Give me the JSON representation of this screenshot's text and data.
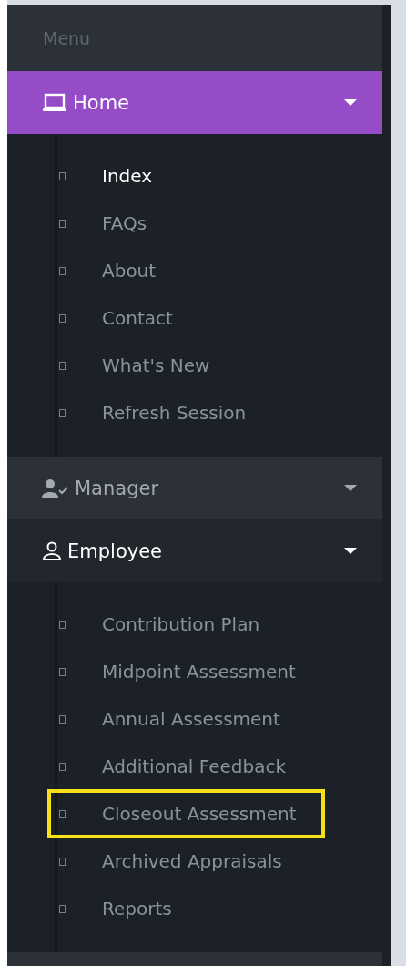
{
  "menu_title": "Menu",
  "groups": [
    {
      "label": "Home",
      "kind": "laptop",
      "active": true,
      "expanded": true,
      "items": [
        {
          "label": "Index",
          "selected": true,
          "highlighted": false
        },
        {
          "label": "FAQs",
          "selected": false,
          "highlighted": false
        },
        {
          "label": "About",
          "selected": false,
          "highlighted": false
        },
        {
          "label": "Contact",
          "selected": false,
          "highlighted": false
        },
        {
          "label": "What's New",
          "selected": false,
          "highlighted": false
        },
        {
          "label": "Refresh Session",
          "selected": false,
          "highlighted": false
        }
      ]
    },
    {
      "label": "Manager",
      "kind": "user-check",
      "active": false,
      "expanded": false
    },
    {
      "label": "Employee",
      "kind": "user",
      "active": false,
      "expanded": true,
      "items": [
        {
          "label": "Contribution Plan",
          "selected": false,
          "highlighted": false
        },
        {
          "label": "Midpoint Assessment",
          "selected": false,
          "highlighted": false
        },
        {
          "label": "Annual Assessment",
          "selected": false,
          "highlighted": false
        },
        {
          "label": "Additional Feedback",
          "selected": false,
          "highlighted": false
        },
        {
          "label": "Closeout Assessment",
          "selected": false,
          "highlighted": true
        },
        {
          "label": "Archived Appraisals",
          "selected": false,
          "highlighted": false
        },
        {
          "label": "Reports",
          "selected": false,
          "highlighted": false
        }
      ]
    }
  ]
}
